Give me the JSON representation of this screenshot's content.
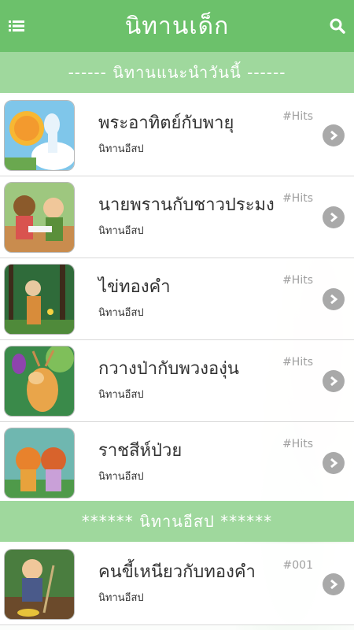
{
  "header": {
    "title": "นิทานเด็ก",
    "menu_icon": "list-menu-icon",
    "search_icon": "search-icon",
    "accent": "#6cc16b"
  },
  "sections": {
    "recommended": "------  นิทานแนะนำวันนี้  ------",
    "aesop": "******  นิทานอีสป  ******"
  },
  "recommended_items": [
    {
      "title": "พระอาทิตย์กับพายุ",
      "category": "นิทานอีสป",
      "tag": "#Hits"
    },
    {
      "title": "นายพรานกับชาวประมง",
      "category": "นิทานอีสป",
      "tag": "#Hits"
    },
    {
      "title": "ไข่ทองคำ",
      "category": "นิทานอีสป",
      "tag": "#Hits"
    },
    {
      "title": "กวางป่ากับพวงองุ่น",
      "category": "นิทานอีสป",
      "tag": "#Hits"
    },
    {
      "title": "ราชสีห์ป่วย",
      "category": "นิทานอีสป",
      "tag": "#Hits"
    }
  ],
  "aesop_items": [
    {
      "title": "คนขี้เหนียวกับทองคำ",
      "category": "นิทานอีสป",
      "tag": "#001"
    }
  ]
}
